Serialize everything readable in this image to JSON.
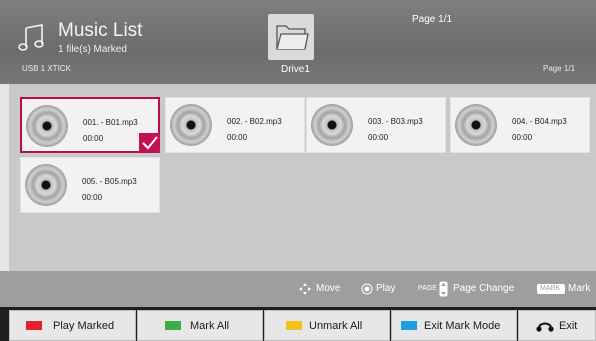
{
  "header": {
    "title": "Music List",
    "marked_count": "1 file(s) Marked",
    "device": "USB 1 XTICK",
    "drive": "Drive1",
    "page_top": "Page 1/1",
    "page_right": "Page 1/1",
    "app_icon": "music-note-icon",
    "folder_icon": "folder-icon"
  },
  "files": [
    {
      "name": "001. - B01.mp3",
      "duration": "00:00",
      "marked": true
    },
    {
      "name": "002. - B02.mp3",
      "duration": "00:00",
      "marked": false
    },
    {
      "name": "003. - B03.mp3",
      "duration": "00:00",
      "marked": false
    },
    {
      "name": "004. - B04.mp3",
      "duration": "00:00",
      "marked": false
    },
    {
      "name": "005. - B05.mp3",
      "duration": "00:00",
      "marked": false
    }
  ],
  "hints": {
    "move": "Move",
    "play": "Play",
    "page_prefix": "PAGE",
    "page_change": "Page Change",
    "mark_key": "MARK",
    "mark": "Mark"
  },
  "buttons": [
    {
      "label": "Play Marked",
      "color": "#e8202b"
    },
    {
      "label": "Mark All",
      "color": "#3dae47"
    },
    {
      "label": "Unmark All",
      "color": "#f2c21d"
    },
    {
      "label": "Exit Mark Mode",
      "color": "#1ea0e0"
    },
    {
      "label": "Exit",
      "icon": "back-icon"
    }
  ],
  "colors": {
    "selection": "#b40e4f",
    "checkmark_bg": "#c21054"
  }
}
